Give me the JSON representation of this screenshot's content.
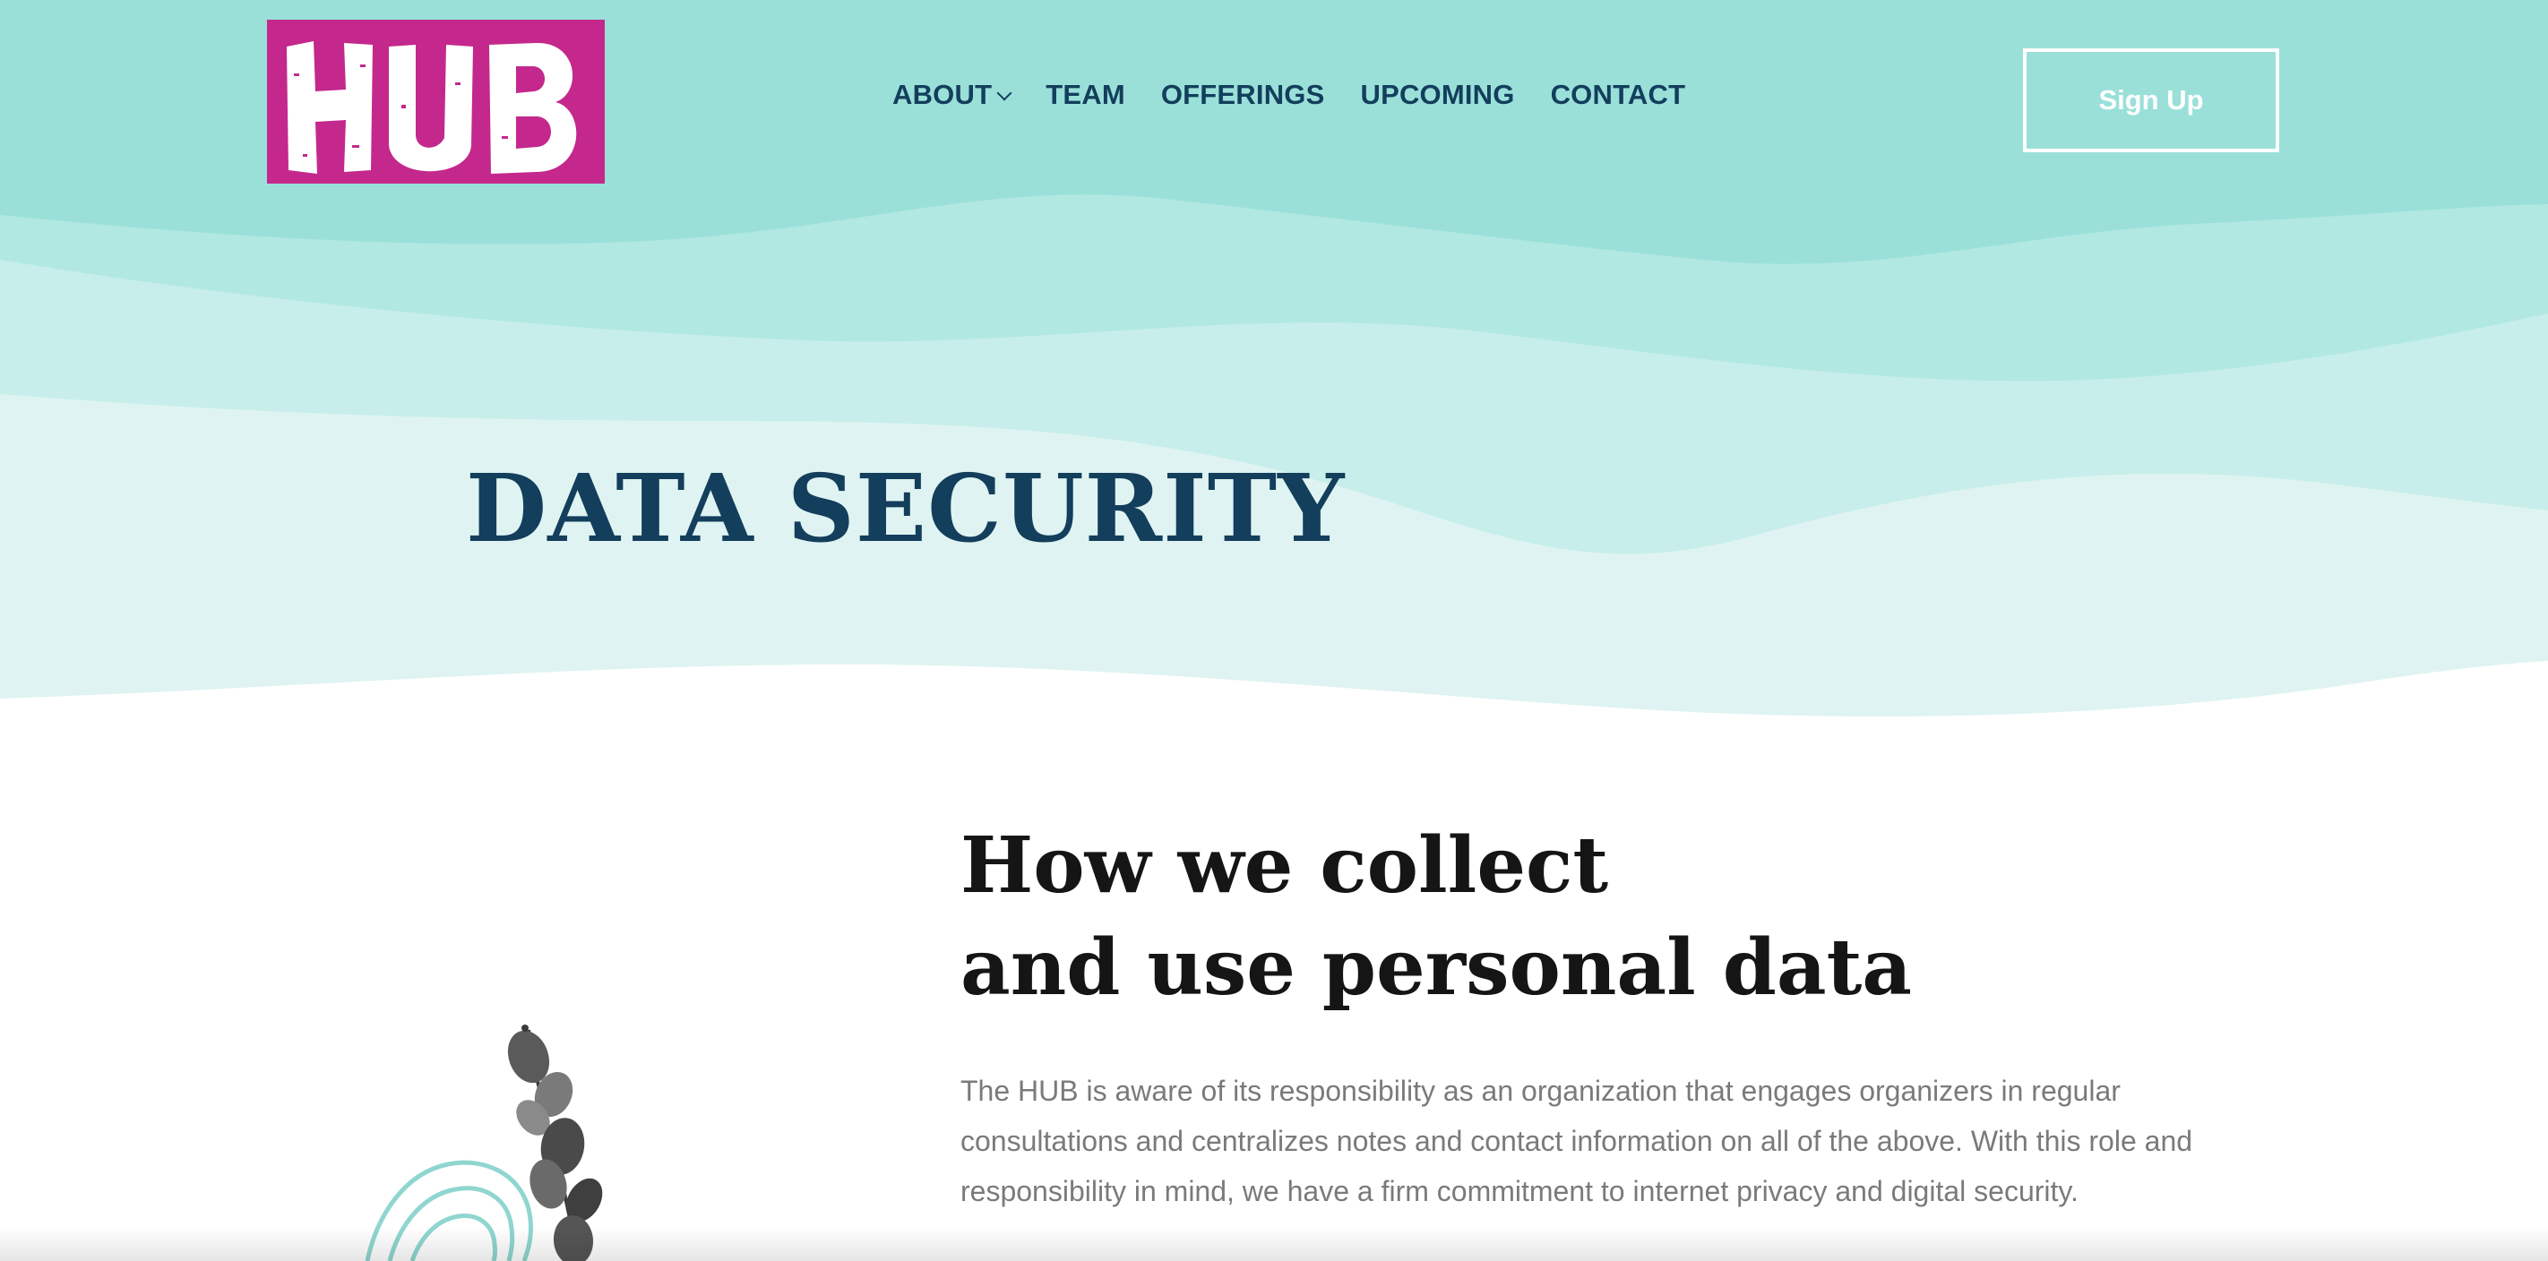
{
  "brand": {
    "logo_text": "HUB",
    "logo_color": "#c4288c"
  },
  "nav": {
    "items": [
      {
        "label": "ABOUT",
        "has_dropdown": true
      },
      {
        "label": "TEAM"
      },
      {
        "label": "OFFERINGS"
      },
      {
        "label": "UPCOMING"
      },
      {
        "label": "CONTACT"
      }
    ],
    "signup_label": "Sign Up"
  },
  "hero": {
    "title": "DATA SECURITY"
  },
  "content": {
    "title_line1": "How we collect",
    "title_line2": "and use personal data",
    "body": "The HUB is aware of its responsibility as an organization that engages organizers in regular consultations and centralizes notes and contact information on all of the above. With this role and responsibility in mind, we have a firm commitment to internet privacy and digital security."
  },
  "colors": {
    "hero_teal": "#9ae0d9",
    "navy": "#133e5c",
    "body_gray": "#7a7a7a",
    "heading_black": "#151515"
  }
}
